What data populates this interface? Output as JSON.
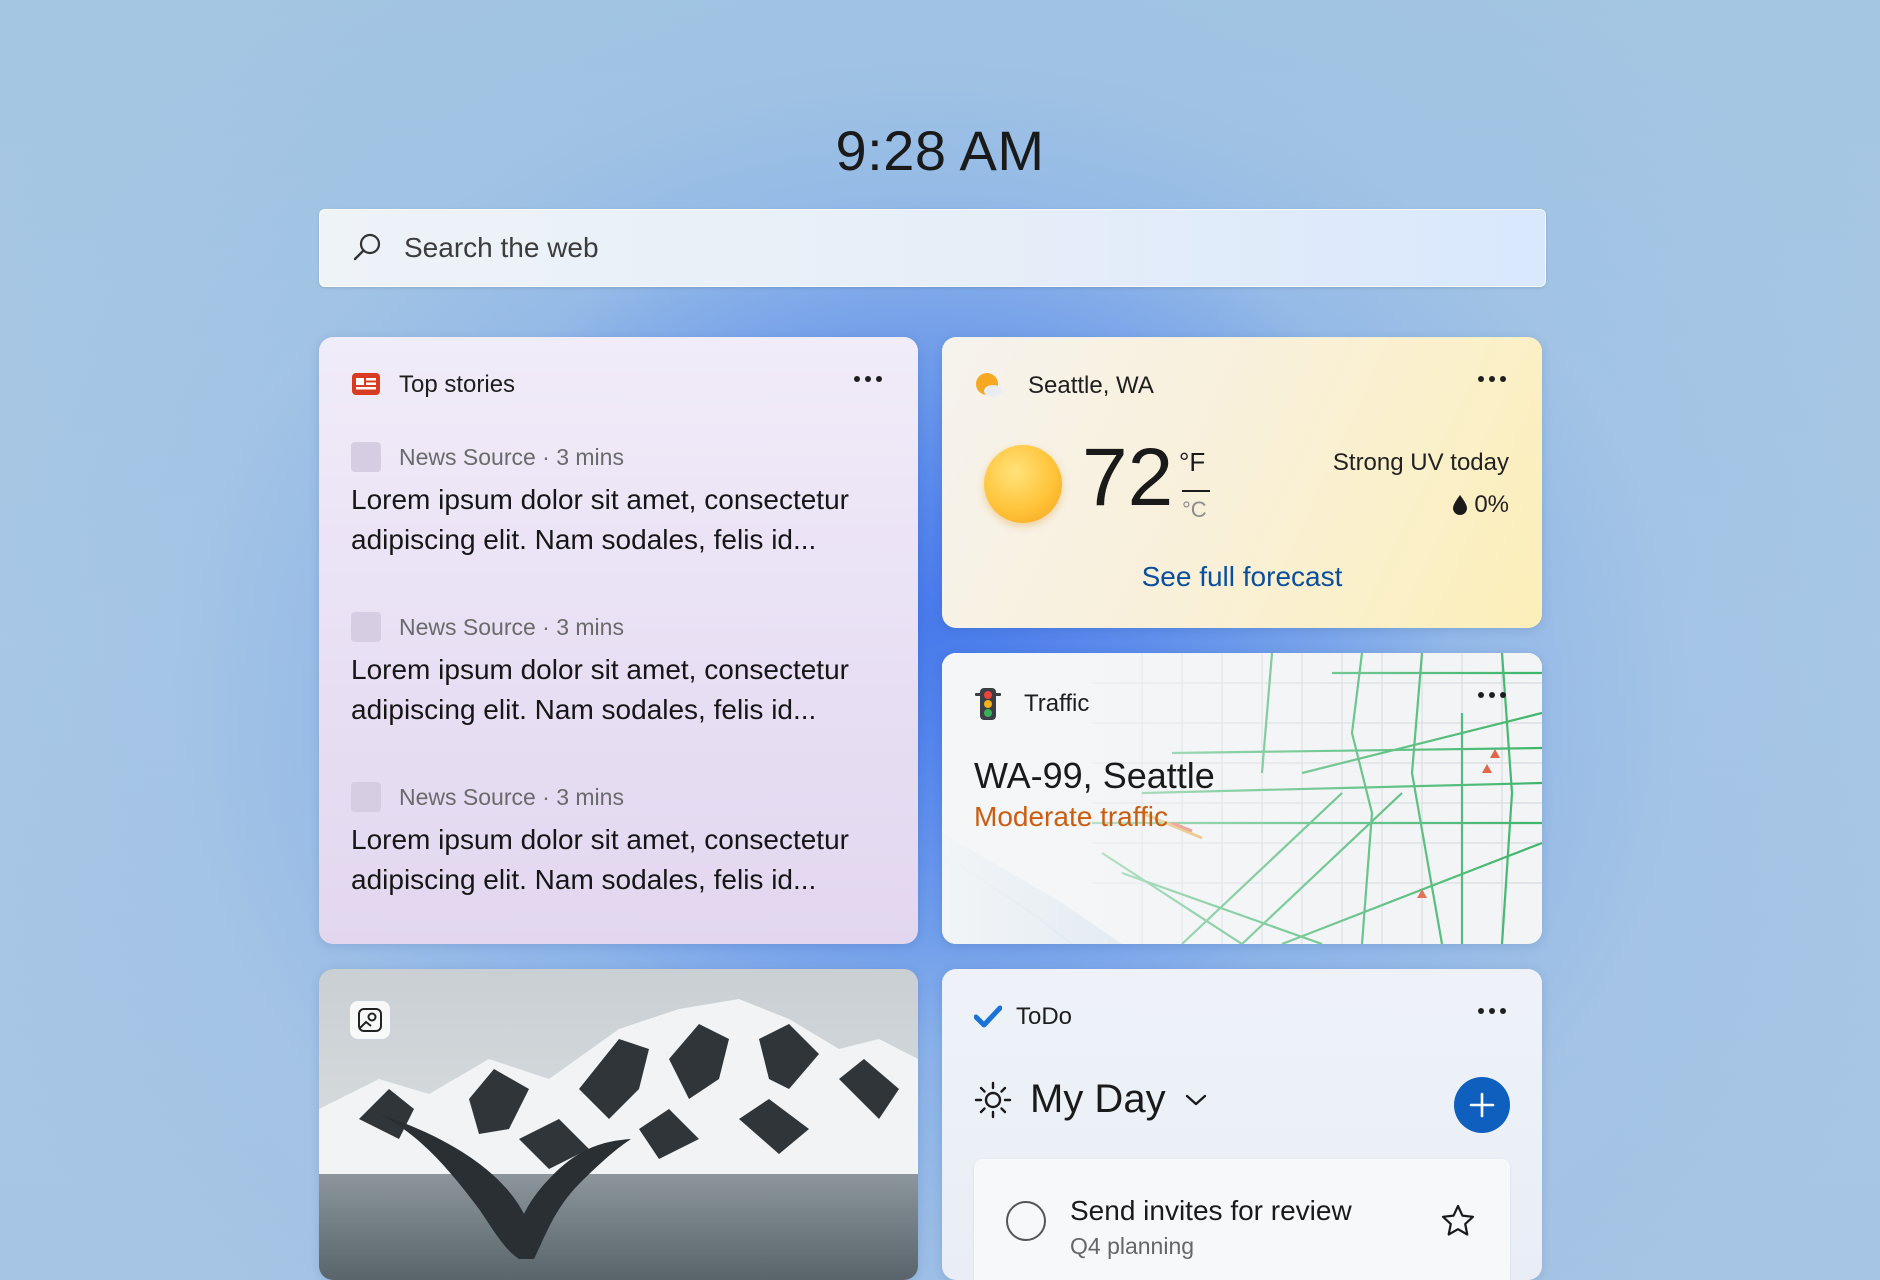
{
  "clock": {
    "time": "9:28 AM"
  },
  "search": {
    "placeholder": "Search the web",
    "icon": "search-icon"
  },
  "top_stories": {
    "title": "Top stories",
    "icon": "news-icon",
    "items": [
      {
        "source": "News Source · 3 mins",
        "headline": "Lorem ipsum dolor sit amet, consectetur adipiscing elit. Nam sodales, felis id..."
      },
      {
        "source": "News Source · 3 mins",
        "headline": "Lorem ipsum dolor sit amet, consectetur adipiscing elit. Nam sodales, felis id..."
      },
      {
        "source": "News Source · 3 mins",
        "headline": "Lorem ipsum dolor sit amet, consectetur adipiscing elit. Nam sodales, felis id..."
      }
    ]
  },
  "weather": {
    "location": "Seattle, WA",
    "icon": "partly-sunny-icon",
    "temperature": "72",
    "unit_f": "°F",
    "unit_c": "°C",
    "uv_note": "Strong UV today",
    "precip": "0%",
    "forecast_link": "See full forecast"
  },
  "traffic": {
    "title": "Traffic",
    "icon": "traffic-light-icon",
    "road": "WA-99, Seattle",
    "status": "Moderate traffic",
    "status_color": "#c95e12"
  },
  "photo": {
    "icon": "photo-icon"
  },
  "todo": {
    "title": "ToDo",
    "icon": "checkmark-icon",
    "list_name": "My Day",
    "task": {
      "title": "Send invites for review",
      "subtitle": "Q4 planning"
    },
    "accent": "#0f5fbf"
  }
}
